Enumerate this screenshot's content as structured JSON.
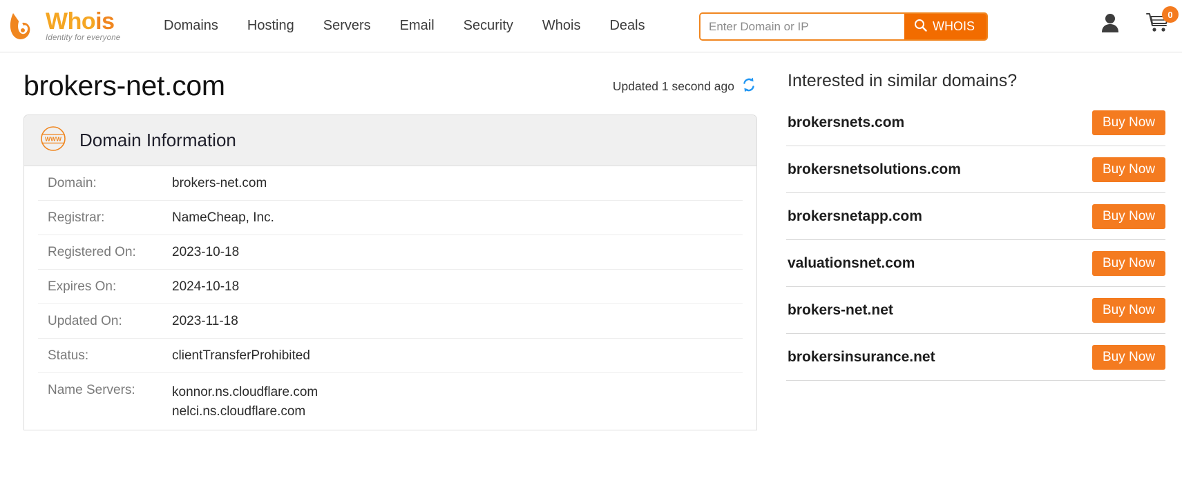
{
  "brand": {
    "name_part1": "Who",
    "name_part2": "is",
    "tagline": "Identity for everyone",
    "accent_orange": "#f26c00",
    "accent_amber": "#f5a623",
    "button_orange": "#f47b20"
  },
  "nav": {
    "items": [
      {
        "label": "Domains"
      },
      {
        "label": "Hosting"
      },
      {
        "label": "Servers"
      },
      {
        "label": "Email"
      },
      {
        "label": "Security"
      },
      {
        "label": "Whois"
      },
      {
        "label": "Deals"
      }
    ]
  },
  "search": {
    "placeholder": "Enter Domain or IP",
    "value": "",
    "button_label": "WHOIS"
  },
  "header_icons": {
    "account": "user-icon",
    "cart": "cart-icon",
    "cart_count": "0"
  },
  "main": {
    "page_title": "brokers-net.com",
    "updated_text": "Updated 1 second ago",
    "refresh_icon": "refresh-icon",
    "card": {
      "icon": "www-globe-icon",
      "title": "Domain Information",
      "rows": [
        {
          "label": "Domain:",
          "value": "brokers-net.com"
        },
        {
          "label": "Registrar:",
          "value": "NameCheap, Inc."
        },
        {
          "label": "Registered On:",
          "value": "2023-10-18"
        },
        {
          "label": "Expires On:",
          "value": "2024-10-18"
        },
        {
          "label": "Updated On:",
          "value": "2023-11-18"
        },
        {
          "label": "Status:",
          "value": "clientTransferProhibited"
        },
        {
          "label": "Name Servers:",
          "value": "konnor.ns.cloudflare.com",
          "value2": "nelci.ns.cloudflare.com"
        }
      ]
    }
  },
  "sidebar": {
    "title": "Interested in similar domains?",
    "buy_label": "Buy Now",
    "domains": [
      {
        "name": "brokersnets.com"
      },
      {
        "name": "brokersnetsolutions.com"
      },
      {
        "name": "brokersnetapp.com"
      },
      {
        "name": "valuationsnet.com"
      },
      {
        "name": "brokers-net.net"
      },
      {
        "name": "brokersinsurance.net"
      }
    ]
  }
}
